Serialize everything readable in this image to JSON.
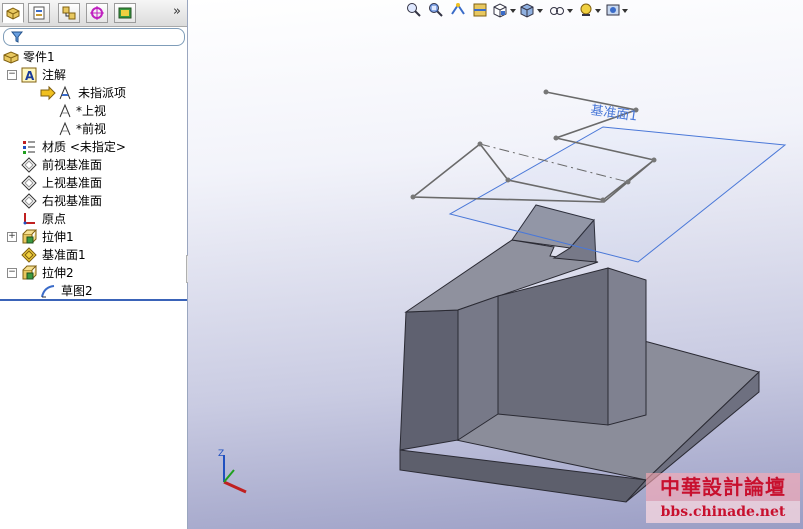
{
  "panel": {
    "more_glyph": "»",
    "tabs": [
      {
        "name": "feature-manager",
        "active": true
      },
      {
        "name": "property-manager",
        "active": false
      },
      {
        "name": "configuration-manager",
        "active": false
      },
      {
        "name": "dimxpert-manager",
        "active": false
      },
      {
        "name": "display-manager",
        "active": false
      }
    ]
  },
  "tree": {
    "items": [
      {
        "label": "零件1",
        "icon": "part-icon"
      },
      {
        "label": "注解",
        "icon": "annotations-icon",
        "expander": "−"
      },
      {
        "label": "未指派项",
        "icon": "unassigned-items-icon"
      },
      {
        "label": "*上视",
        "icon": "annotation-view-icon"
      },
      {
        "label": "*前视",
        "icon": "annotation-view-icon"
      },
      {
        "label": "材质 <未指定>",
        "icon": "material-icon"
      },
      {
        "label": "前视基准面",
        "icon": "plane-icon"
      },
      {
        "label": "上视基准面",
        "icon": "plane-icon"
      },
      {
        "label": "右视基准面",
        "icon": "plane-icon"
      },
      {
        "label": "原点",
        "icon": "origin-icon"
      },
      {
        "label": "拉伸1",
        "icon": "extrude-icon",
        "expander": "+"
      },
      {
        "label": "基准面1",
        "icon": "plane-icon"
      },
      {
        "label": "拉伸2",
        "icon": "extrude-icon",
        "expander": "−"
      },
      {
        "label": "草图2",
        "icon": "sketch-icon"
      }
    ]
  },
  "viewport": {
    "plane_label": "基准面1",
    "triad_label": "Z"
  },
  "watermark": {
    "title": "中華設計論壇",
    "url": "bbs.chinade.net"
  },
  "colors": {
    "selection_blue": "#3a63b8",
    "plane_blue": "#4a78d8",
    "model_face_top": "#8a8c99",
    "model_face_front": "#5f6170",
    "model_face_side": "#727484"
  }
}
